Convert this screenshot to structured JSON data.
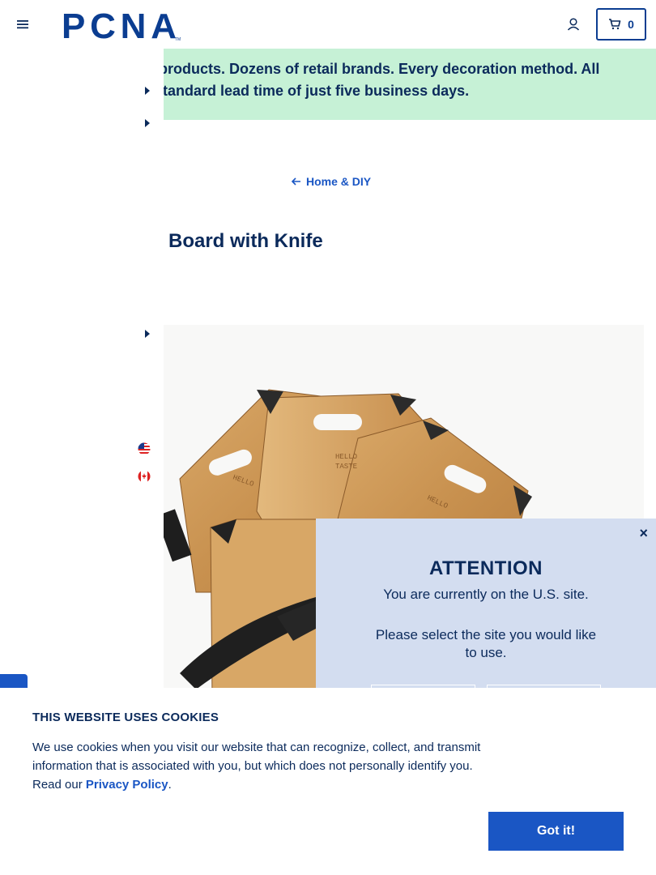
{
  "header": {
    "logo_text": "PCNA",
    "logo_tm": "TM",
    "cart_count": "0",
    "brand_color": "#0b3d91"
  },
  "banner": {
    "text": "ls of products. Dozens of retail brands. Every decoration method. All\nth a standard lead time of just five business days.",
    "background": "#c6f1d6"
  },
  "breadcrumb": {
    "back_label": "Home & DIY"
  },
  "product": {
    "title": "Board with Knife",
    "board_imprint": "HELLO TASTE"
  },
  "modal": {
    "title": "ATTENTION",
    "line1": "You are currently on the U.S. site.",
    "line2": "Please select the site you would like to use.",
    "close_label": "×"
  },
  "cookie": {
    "title": "THIS WEBSITE USES COOKIES",
    "text_before": "We use cookies when you visit our website that can recognize, collect, and transmit information that is associated with you, but which does not personally identify you. Read our ",
    "link_label": "Privacy Policy",
    "text_after": ".",
    "button_label": "Got it!"
  },
  "icons": [
    "menu-icon",
    "account-icon",
    "cart-icon",
    "arrow-left-icon",
    "us-flag-icon",
    "canada-flag-icon",
    "caret-right-icon",
    "close-icon"
  ]
}
